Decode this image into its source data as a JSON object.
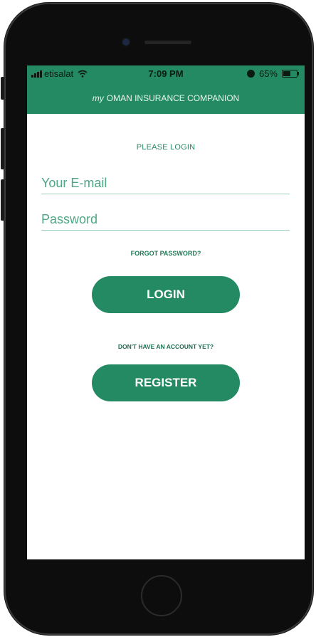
{
  "status_bar": {
    "carrier": "etisalat",
    "time": "7:09 PM",
    "battery": "65%",
    "battery_level": 0.65,
    "icons": [
      "signal-icon",
      "wifi-icon",
      "alarm-icon",
      "battery-icon"
    ]
  },
  "header": {
    "prefix": "my",
    "title": "OMAN INSURANCE COMPANION"
  },
  "login": {
    "heading": "PLEASE LOGIN",
    "email_placeholder": "Your E-mail",
    "password_placeholder": "Password",
    "forgot_label": "FORGOT PASSWORD?",
    "login_label": "LOGIN",
    "no_account_text": "DON'T HAVE AN ACCOUNT YET?",
    "register_label": "REGISTER"
  },
  "colors": {
    "brand_green": "#238a63",
    "text_green": "#2a8a64"
  }
}
